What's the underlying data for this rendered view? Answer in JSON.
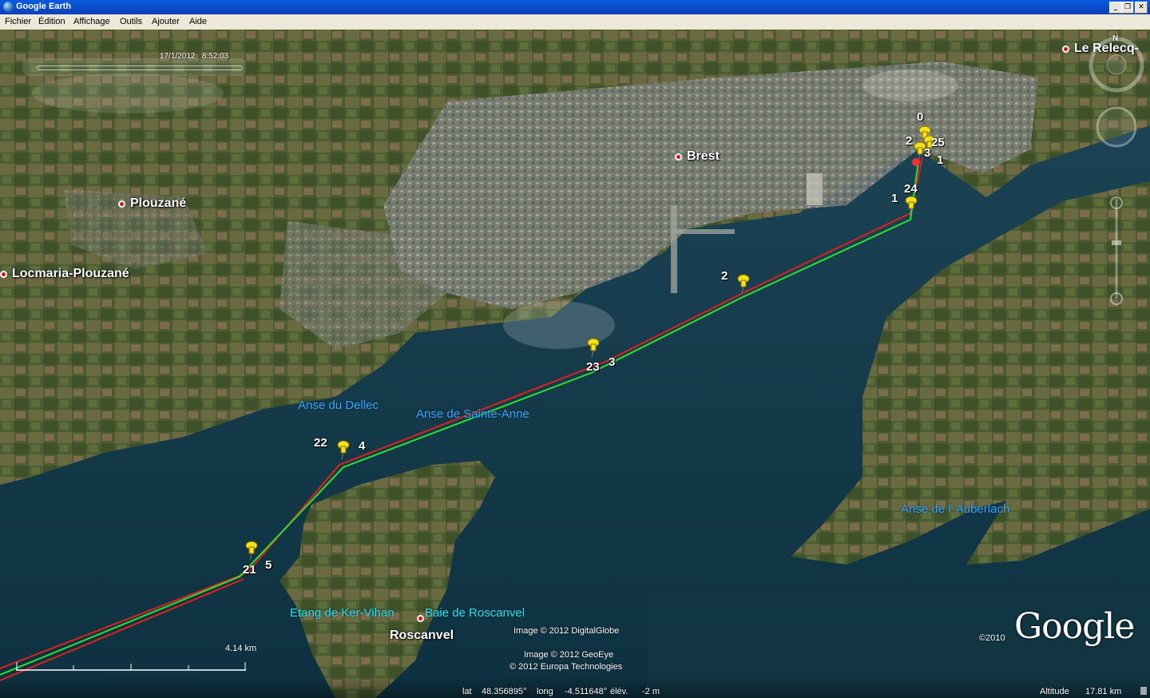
{
  "window": {
    "title": "Google Earth",
    "buttons": [
      "_",
      "❐",
      "✕"
    ]
  },
  "menu": [
    "Fichier",
    "Édition",
    "Affichage",
    "Outils",
    "Ajouter",
    "Aide"
  ],
  "time_slider": {
    "date": "17/1/2012",
    "time": "8:52:03"
  },
  "places": [
    {
      "name": "Brest"
    },
    {
      "name": "Plouzané"
    },
    {
      "name": "Locmaria-Plouzané"
    },
    {
      "name": "Roscanvel"
    },
    {
      "name": "Le Relecq-"
    }
  ],
  "water_labels": [
    "Anse du Dellec",
    "Anse de Sainte-Anne",
    "Anse de l' Auberlach",
    "Etang de Ker-Vihan",
    "Baie de Roscanvel"
  ],
  "waypoints": [
    "0",
    "25",
    "2",
    "3",
    "1",
    "24",
    "1",
    "2",
    "23",
    "3",
    "22",
    "4",
    "21",
    "5"
  ],
  "scale": {
    "label": "4.14  km"
  },
  "credits": [
    "Image © 2012 DigitalGlobe",
    "Image © 2012 GeoEye",
    "© 2012 Europa Technologies"
  ],
  "copyright": "©2010",
  "logo": "Google",
  "status": {
    "lat_label": "lat",
    "lat": "48.356895°",
    "long_label": "long",
    "long": "-4.511648°",
    "elev_label": "élév.",
    "elev": "-2 m",
    "alt_label": "Altitude",
    "alt": "17.81 km"
  },
  "compass": "N",
  "colors": {
    "track_red": "#e0201a",
    "track_green": "#30e030",
    "pin": "#f5e31a",
    "title_bar": "#0b4fcf"
  }
}
